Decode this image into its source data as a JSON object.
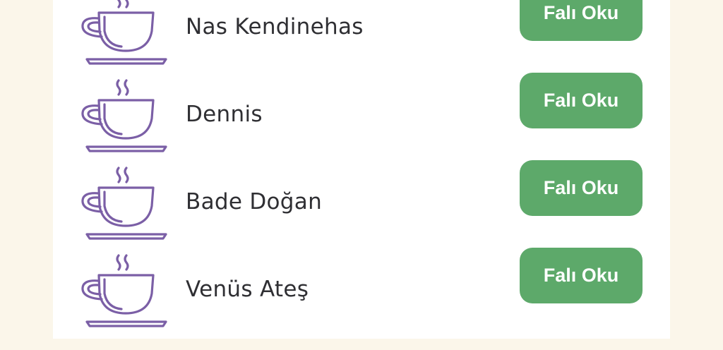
{
  "items": [
    {
      "name": "Nas Kendinehas",
      "button_label": "Falı Oku",
      "icon": "coffee-cup-icon"
    },
    {
      "name": "Dennis",
      "button_label": "Falı Oku",
      "icon": "coffee-cup-icon"
    },
    {
      "name": "Bade Doğan",
      "button_label": "Falı Oku",
      "icon": "coffee-cup-icon"
    },
    {
      "name": "Venüs Ateş",
      "button_label": "Falı Oku",
      "icon": "coffee-cup-icon"
    }
  ],
  "colors": {
    "background": "#fbf6ea",
    "panel": "#ffffff",
    "button": "#5da96a",
    "icon": "#7b5fa6",
    "text": "#2f2f33"
  }
}
